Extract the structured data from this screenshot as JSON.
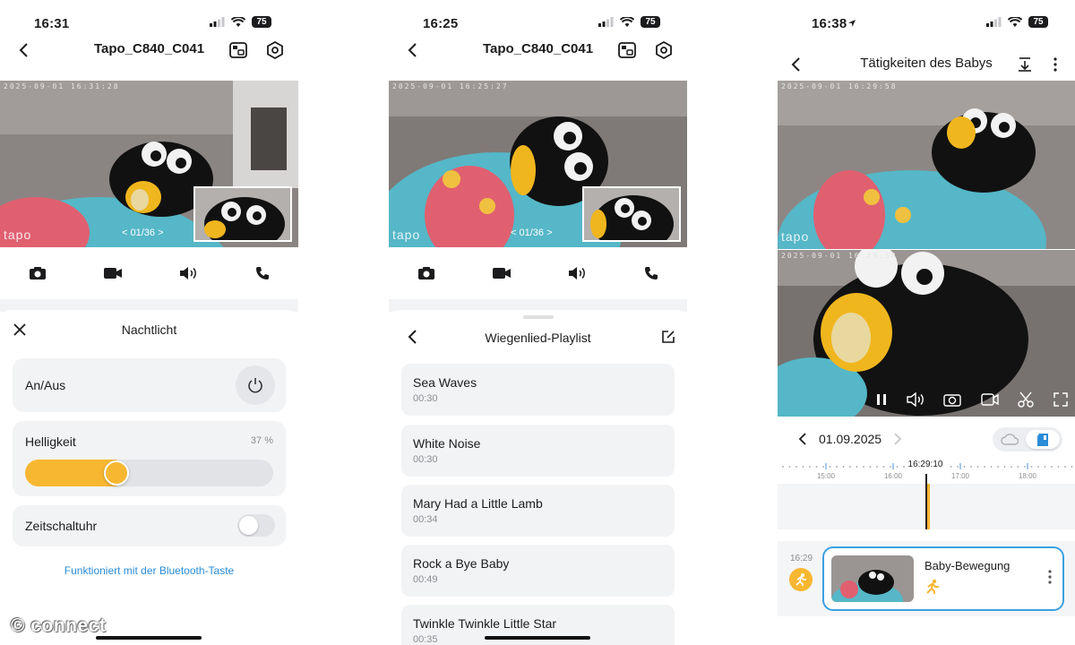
{
  "watermark": "© connect",
  "screens": [
    {
      "status_time": "16:31",
      "battery": "75",
      "title": "Tapo_C840_C041",
      "video": {
        "timestamp": "2025-09-01 16:31:28",
        "counter": "< 01/36 >",
        "logo": "tapo"
      },
      "sheet": {
        "title": "Nachtlicht",
        "on_off_label": "An/Aus",
        "brightness_label": "Helligkeit",
        "brightness_value": "37 %",
        "brightness_fraction": 0.37,
        "timer_label": "Zeitschaltuhr",
        "timer_on": false,
        "link": "Funktioniert mit der Bluetooth-Taste"
      }
    },
    {
      "status_time": "16:25",
      "battery": "75",
      "title": "Tapo_C840_C041",
      "video": {
        "timestamp": "2025-09-01 16:25:27",
        "counter": "< 01/36 >",
        "logo": "tapo"
      },
      "sheet": {
        "title": "Wiegenlied-Playlist",
        "songs": [
          {
            "title": "Sea Waves",
            "duration": "00:30"
          },
          {
            "title": "White Noise",
            "duration": "00:30"
          },
          {
            "title": "Mary Had a Little Lamb",
            "duration": "00:34"
          },
          {
            "title": "Rock a Bye Baby",
            "duration": "00:49"
          },
          {
            "title": "Twinkle Twinkle Little Star",
            "duration": "00:35"
          }
        ]
      }
    },
    {
      "status_time": "16:38",
      "battery": "75",
      "title": "Tätigkeiten des Babys",
      "video": {
        "timestamp": "2025-09-01 16:29:58",
        "timestamp2": "2025-09-01 16:29:58",
        "logo": "tapo"
      },
      "date": "01.09.2025",
      "timeline": {
        "current": "16:29:10",
        "ticks": [
          "15:00",
          "16:00",
          "17:00",
          "18:00"
        ]
      },
      "event": {
        "time": "16:29",
        "title": "Baby-Bewegung"
      }
    }
  ],
  "colors": {
    "accent": "#f7b731",
    "link": "#2a8cd8",
    "card": "#f2f3f5",
    "event_border": "#3aa0e0"
  },
  "icons": [
    "back-arrow-icon",
    "layout-icon",
    "settings-icon",
    "camera-icon",
    "video-record-icon",
    "speaker-icon",
    "phone-icon",
    "close-icon",
    "power-icon",
    "edit-icon",
    "download-icon",
    "more-icon",
    "pause-icon",
    "scissors-icon",
    "fullscreen-icon",
    "cloud-icon",
    "sd-card-icon",
    "motion-icon"
  ]
}
